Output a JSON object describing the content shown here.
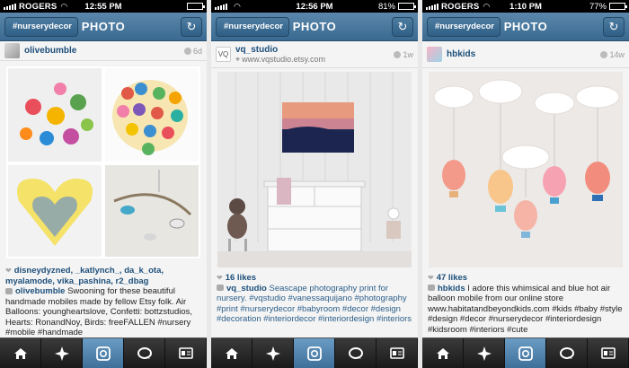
{
  "screens": [
    {
      "status": {
        "carrier": "ROGERS",
        "time": "12:55 PM",
        "battery": "",
        "battery_pct": 0.85
      },
      "nav": {
        "back_label": "#nurserydecor",
        "title": "PHOTO"
      },
      "post": {
        "username": "olivebumble",
        "age": "6d",
        "likes_users": "disneydyzned, _katlynch_, da_k_ota, myalamode, vika_pashina, r2_dbag",
        "caption_user": "olivebumble",
        "caption_text": " Swooning for these beautiful handmade mobiles made by fellow Etsy folk. Air Balloons: youngheartslove, Confetti: bottzstudios, Hearts: RonandNoy, Birds: freeFALLEN #nursery #mobile #handmade"
      }
    },
    {
      "status": {
        "carrier": "",
        "time": "12:56 PM",
        "battery": "81%",
        "battery_pct": 0.81
      },
      "nav": {
        "back_label": "#nurserydecor",
        "title": "PHOTO"
      },
      "post": {
        "username": "vq_studio",
        "location": "www.vqstudio.etsy.com",
        "age": "1w",
        "likes": "16 likes",
        "caption_user": "vq_studio",
        "caption_text": " Seascape photography print for nursery. #vqstudio #vanessaquijano #photography #print #nurserydecor #babyroom #decor #design #decoration #interiordecor #interiordesign #interiors"
      }
    },
    {
      "status": {
        "carrier": "ROGERS",
        "time": "1:10 PM",
        "battery": "77%",
        "battery_pct": 0.77
      },
      "nav": {
        "back_label": "#nurserydecor",
        "title": "PHOTO"
      },
      "post": {
        "username": "hbkids",
        "age": "14w",
        "likes": "47 likes",
        "caption_user": "hbkids",
        "caption_text": " I adore this whimsical and blue hot air balloon mobile from our online store www.habitatandbeyondkids.com #kids #baby #style #design #decor #nurserydecor #interiordesign #kidsroom #interiors #cute"
      }
    }
  ],
  "tabs": [
    {
      "icon": "home-icon"
    },
    {
      "icon": "explore-star-icon"
    },
    {
      "icon": "camera-icon"
    },
    {
      "icon": "news-bubble-icon"
    },
    {
      "icon": "profile-card-icon"
    }
  ]
}
